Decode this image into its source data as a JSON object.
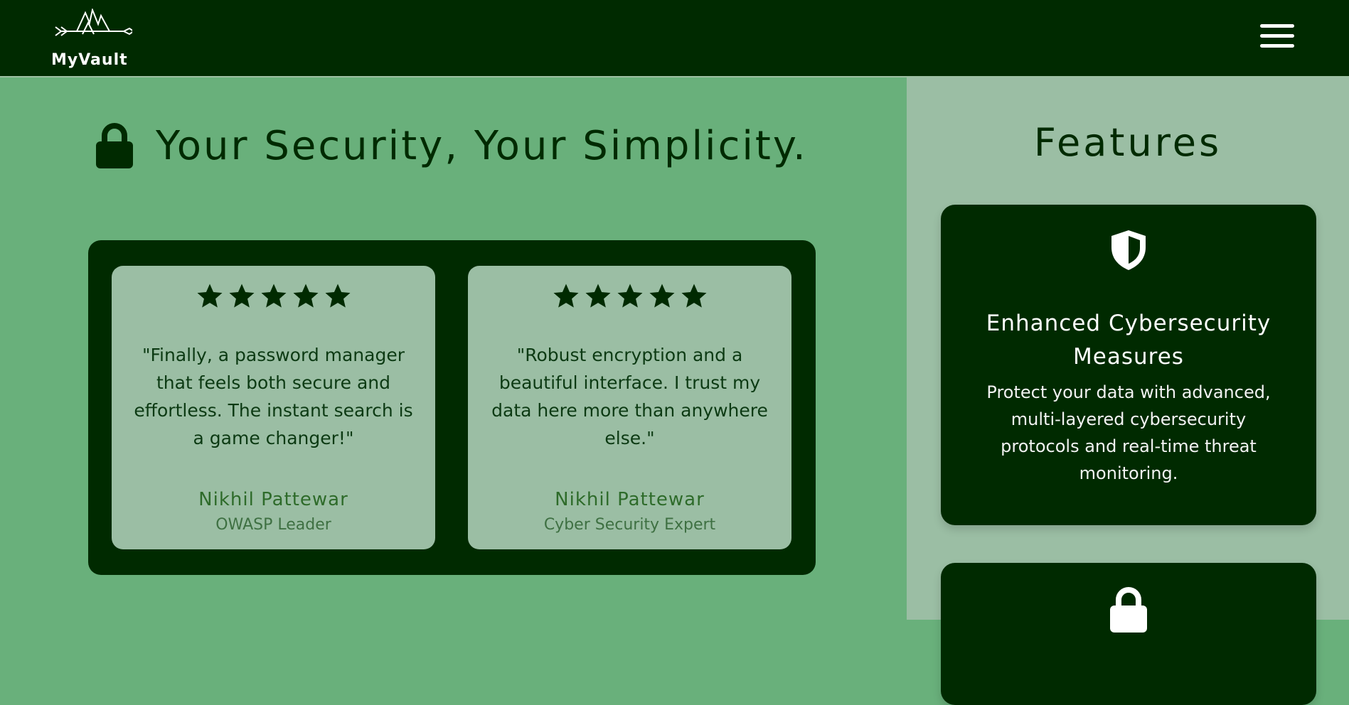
{
  "header": {
    "brand": "MyVault",
    "menu_icon": "hamburger-menu-icon"
  },
  "hero": {
    "icon": "lock-icon",
    "title": "Your Security, Your Simplicity."
  },
  "testimonials": [
    {
      "rating": 5,
      "quote": "\"Finally, a password manager that feels both secure and effortless. The instant search is a game changer!\"",
      "name": "Nikhil Pattewar",
      "role": "OWASP Leader"
    },
    {
      "rating": 5,
      "quote": "\"Robust encryption and a beautiful interface. I trust my data here more than anywhere else.\"",
      "name": "Nikhil Pattewar",
      "role": "Cyber Security Expert"
    }
  ],
  "features": {
    "title": "Features",
    "items": [
      {
        "icon": "shield-icon",
        "heading": "Enhanced Cybersecurity Measures",
        "description": "Protect your data with advanced, multi-layered cybersecurity protocols and real-time threat monitoring."
      },
      {
        "icon": "lock-icon"
      }
    ]
  },
  "colors": {
    "dark_green": "#002a00",
    "mid_green": "#69b07b",
    "light_green": "#9bbea4"
  }
}
